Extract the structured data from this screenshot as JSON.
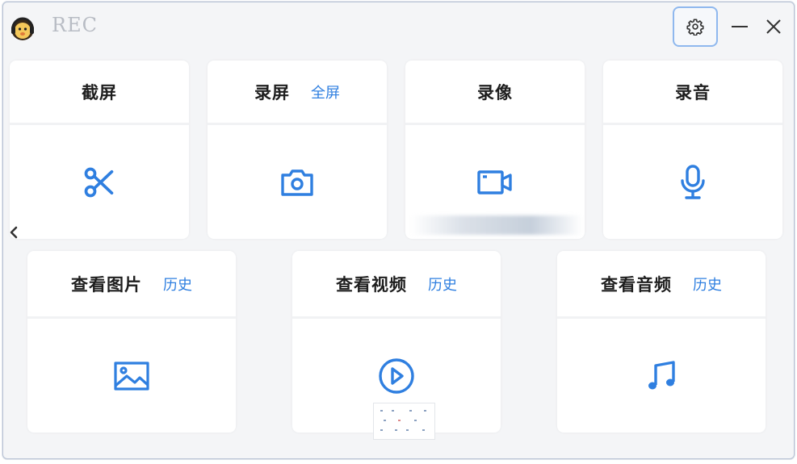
{
  "window": {
    "title": "REC",
    "accent_color": "#2f7fe0",
    "icons": {
      "logo": "monkey-headphones-logo",
      "settings": "gear-icon",
      "minimize": "minimize-icon",
      "close": "close-icon",
      "back": "chevron-left-icon"
    }
  },
  "top_cards": [
    {
      "title": "截屏",
      "link": "",
      "icon": "scissors-icon"
    },
    {
      "title": "录屏",
      "link": "全屏",
      "icon": "camera-icon"
    },
    {
      "title": "录像",
      "link": "",
      "icon": "video-camera-icon"
    },
    {
      "title": "录音",
      "link": "",
      "icon": "microphone-icon"
    }
  ],
  "bottom_cards": [
    {
      "title": "查看图片",
      "link": "历史",
      "icon": "image-icon"
    },
    {
      "title": "查看视频",
      "link": "历史",
      "icon": "play-circle-icon"
    },
    {
      "title": "查看音频",
      "link": "历史",
      "icon": "music-note-icon"
    }
  ]
}
